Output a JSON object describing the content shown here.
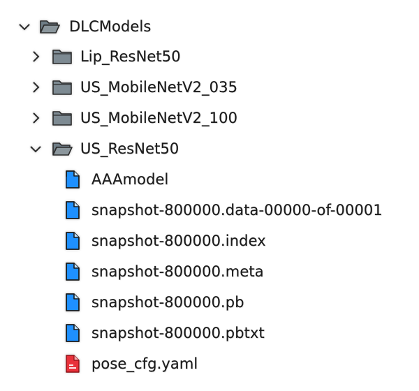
{
  "tree": {
    "root": {
      "label": "DLCModels",
      "expanded": true,
      "icon": "folder-open-icon"
    },
    "folders": [
      {
        "label": "Lip_ResNet50",
        "expanded": false,
        "icon": "folder-closed-icon"
      },
      {
        "label": "US_MobileNetV2_035",
        "expanded": false,
        "icon": "folder-closed-icon"
      },
      {
        "label": "US_MobileNetV2_100",
        "expanded": false,
        "icon": "folder-closed-icon"
      },
      {
        "label": "US_ResNet50",
        "expanded": true,
        "icon": "folder-open-icon"
      }
    ],
    "files": [
      {
        "label": "AAAmodel",
        "icon": "file-icon",
        "color": "#1e90ff"
      },
      {
        "label": "snapshot-800000.data-00000-of-00001",
        "icon": "file-icon",
        "color": "#1e90ff"
      },
      {
        "label": "snapshot-800000.index",
        "icon": "file-icon",
        "color": "#1e90ff"
      },
      {
        "label": "snapshot-800000.meta",
        "icon": "file-icon",
        "color": "#1e90ff"
      },
      {
        "label": "snapshot-800000.pb",
        "icon": "file-icon",
        "color": "#1e90ff"
      },
      {
        "label": "snapshot-800000.pbtxt",
        "icon": "file-icon",
        "color": "#1e90ff"
      },
      {
        "label": "pose_cfg.yaml",
        "icon": "yaml-file-icon",
        "color": "#e8313a"
      }
    ]
  },
  "colors": {
    "folder_fill": "#7d8a92",
    "folder_open_fill": "#8b969c",
    "file_blue": "#1e90ff",
    "file_red": "#e8313a",
    "text": "#1c1c1c"
  }
}
